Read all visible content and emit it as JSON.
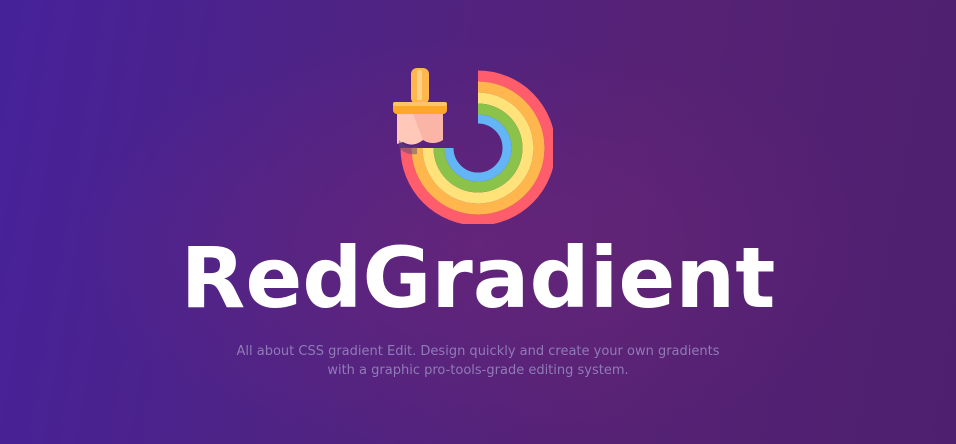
{
  "hero": {
    "title": "RedGradient",
    "subtitle_line1": "All about CSS gradient Edit. Design quickly and create your own gradients",
    "subtitle_line2": "with a graphic pro-tools-grade editing system.",
    "logo_icon": "paintbrush-rainbow-icon"
  },
  "colors": {
    "background_start": "#46229a",
    "background_end": "#4e1f6f",
    "title": "#ffffff",
    "subtitle": "#8f7bb6",
    "rainbow": [
      "#ff5d6c",
      "#ffb74d",
      "#ffe27a",
      "#8bc34a",
      "#64b5f6"
    ]
  }
}
